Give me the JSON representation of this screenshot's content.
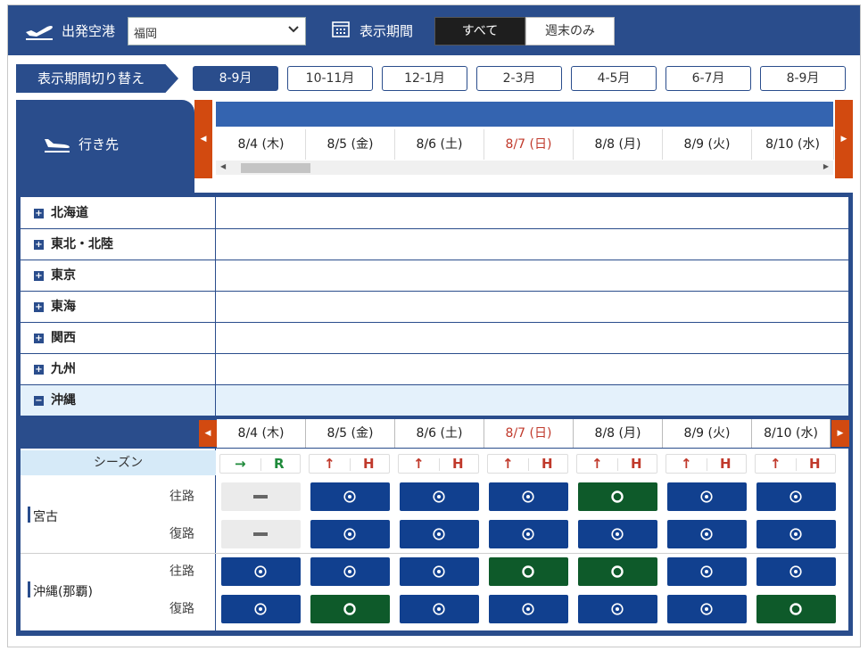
{
  "header": {
    "airport_label": "出発空港",
    "airport_value": "福岡",
    "period_label": "表示期間",
    "seg_all": "すべて",
    "seg_weekend": "週末のみ"
  },
  "period_switch": {
    "title": "表示期間切り替え",
    "tabs": [
      "8-9月",
      "10-11月",
      "12-1月",
      "2-3月",
      "4-5月",
      "6-7月",
      "8-9月"
    ],
    "active_index": 0
  },
  "destination": {
    "label": "行き先"
  },
  "dates": [
    {
      "label": "8/4 (木)",
      "sunday": false
    },
    {
      "label": "8/5 (金)",
      "sunday": false
    },
    {
      "label": "8/6 (土)",
      "sunday": false
    },
    {
      "label": "8/7 (日)",
      "sunday": true
    },
    {
      "label": "8/8 (月)",
      "sunday": false
    },
    {
      "label": "8/9 (火)",
      "sunday": false
    },
    {
      "label": "8/10 (水)",
      "sunday": false
    }
  ],
  "regions": [
    {
      "name": "北海道",
      "toggle": "+"
    },
    {
      "name": "東北・北陸",
      "toggle": "+"
    },
    {
      "name": "東京",
      "toggle": "+"
    },
    {
      "name": "東海",
      "toggle": "+"
    },
    {
      "name": "関西",
      "toggle": "+"
    },
    {
      "name": "九州",
      "toggle": "+"
    },
    {
      "name": "沖縄",
      "toggle": "−"
    }
  ],
  "season": {
    "label": "シーズン",
    "cols": [
      {
        "arrow": "→",
        "code": "R",
        "color": "#1e8a3a"
      },
      {
        "arrow": "↑",
        "code": "H",
        "color": "#c0392b"
      },
      {
        "arrow": "↑",
        "code": "H",
        "color": "#c0392b"
      },
      {
        "arrow": "↑",
        "code": "H",
        "color": "#c0392b"
      },
      {
        "arrow": "↑",
        "code": "H",
        "color": "#c0392b"
      },
      {
        "arrow": "↑",
        "code": "H",
        "color": "#c0392b"
      },
      {
        "arrow": "↑",
        "code": "H",
        "color": "#c0392b"
      }
    ]
  },
  "airports": [
    {
      "name": "宮古",
      "rows": [
        {
          "route": "往路",
          "cells": [
            "n",
            "b",
            "b",
            "b",
            "g",
            "b",
            "b"
          ]
        },
        {
          "route": "復路",
          "cells": [
            "n",
            "b",
            "b",
            "b",
            "b",
            "b",
            "b"
          ]
        }
      ]
    },
    {
      "name": "沖縄(那覇)",
      "rows": [
        {
          "route": "往路",
          "cells": [
            "b",
            "b",
            "b",
            "g",
            "g",
            "b",
            "b"
          ]
        },
        {
          "route": "復路",
          "cells": [
            "b",
            "g",
            "b",
            "b",
            "b",
            "b",
            "g"
          ]
        }
      ]
    }
  ],
  "colors": {
    "primary": "#2a4d8c",
    "accent": "#d24a10",
    "avail_blue": "#11408f",
    "avail_green": "#0e5a2a",
    "sunday": "#c0392b"
  }
}
